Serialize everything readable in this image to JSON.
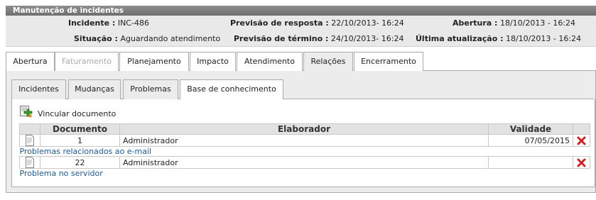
{
  "header": {
    "title": "Manutenção de incidentes"
  },
  "info": {
    "incidente_label": "Incidente :",
    "incidente_value": "INC-486",
    "situacao_label": "Situação :",
    "situacao_value": "Aguardando atendimento",
    "prev_resposta_label": "Previsão de resposta :",
    "prev_resposta_value": "22/10/2013- 16:24",
    "prev_termino_label": "Previsão de término :",
    "prev_termino_value": "24/10/2013- 16:24",
    "abertura_label": "Abertura :",
    "abertura_value": "18/10/2013 - 16:24",
    "ultima_label": "Última atualização :",
    "ultima_value": "18/10/2013 - 16:24"
  },
  "main_tabs": [
    {
      "label": "Abertura",
      "state": "normal"
    },
    {
      "label": "Faturamento",
      "state": "disabled"
    },
    {
      "label": "Planejamento",
      "state": "normal"
    },
    {
      "label": "Impacto",
      "state": "normal"
    },
    {
      "label": "Atendimento",
      "state": "normal"
    },
    {
      "label": "Relações",
      "state": "active"
    },
    {
      "label": "Encerramento",
      "state": "normal"
    }
  ],
  "sub_tabs": [
    {
      "label": "Incidentes",
      "state": "normal"
    },
    {
      "label": "Mudanças",
      "state": "normal"
    },
    {
      "label": "Problemas",
      "state": "normal"
    },
    {
      "label": "Base de conhecimento",
      "state": "active"
    }
  ],
  "actions": {
    "link_document": "Vincular documento",
    "add_icon": "add-document-icon"
  },
  "table": {
    "columns": [
      "Documento",
      "Elaborador",
      "Validade"
    ],
    "rows": [
      {
        "documento": "1",
        "elaborador": "Administrador",
        "validade": "07/05/2015",
        "titulo": "Problemas relacionados ao e-mail"
      },
      {
        "documento": "22",
        "elaborador": "Administrador",
        "validade": "",
        "titulo": "Problema no servidor"
      }
    ]
  },
  "colors": {
    "title_bar": "#7a7a7a",
    "info_bg": "#e9e9e9",
    "link": "#1a5a9a",
    "delete": "#d42020",
    "add": "#3a9a2a"
  }
}
